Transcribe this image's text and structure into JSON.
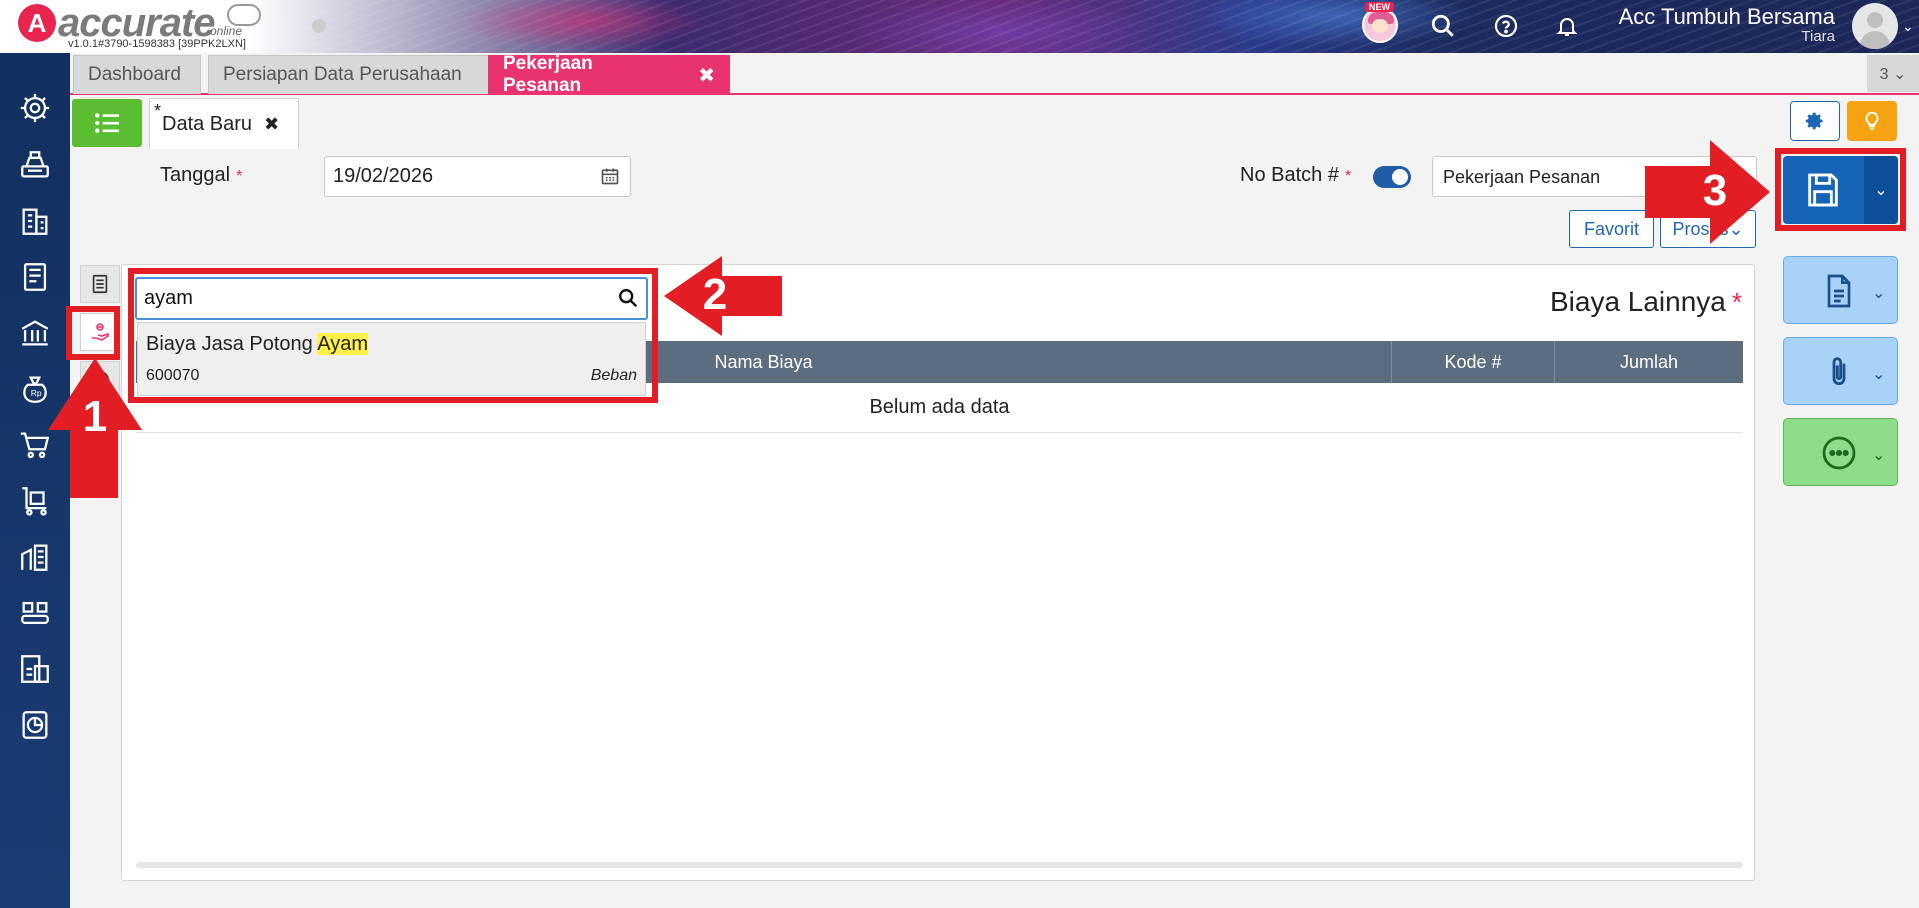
{
  "header": {
    "logo_text": "accurate",
    "logo_sub": "online",
    "version": "v1.0.1#3790-1598383 [39PPK2LXN]",
    "new_badge": "NEW",
    "company": "Acc Tumbuh Bersama",
    "user": "Tiara"
  },
  "tabs": [
    {
      "label": "Dashboard"
    },
    {
      "label": "Persiapan Data Perusahaan"
    },
    {
      "label": "Pekerjaan Pesanan",
      "close": "✖"
    }
  ],
  "tab_counter": "3 ⌄",
  "doc_tab": {
    "star": "*",
    "label": "Data Baru",
    "close": "✖"
  },
  "form": {
    "tanggal_label": "Tanggal",
    "tanggal_value": "19/02/2026",
    "batch_label": "No Batch #",
    "batch_value": "Pekerjaan Pesanan",
    "required_mark": "*",
    "favorit_label": "Favorit",
    "proses_label": "Proses"
  },
  "search": {
    "value": "ayam",
    "result_name_prefix": "Biaya Jasa Potong ",
    "result_name_match": "Ayam",
    "result_code": "600070",
    "result_type": "Beban"
  },
  "table": {
    "title": "Biaya Lainnya",
    "columns": [
      "Nama Biaya",
      "Kode #",
      "Jumlah"
    ],
    "empty_text": "Belum ada data"
  },
  "annotations": {
    "step1": "1",
    "step2": "2",
    "step3": "3",
    "color": "#e31d24"
  },
  "colors": {
    "accent_pink": "#e8336f",
    "sidebar": "#12305f",
    "primary_blue": "#1664b8",
    "list_green": "#5bbd32",
    "bulb_orange": "#f5a313"
  }
}
